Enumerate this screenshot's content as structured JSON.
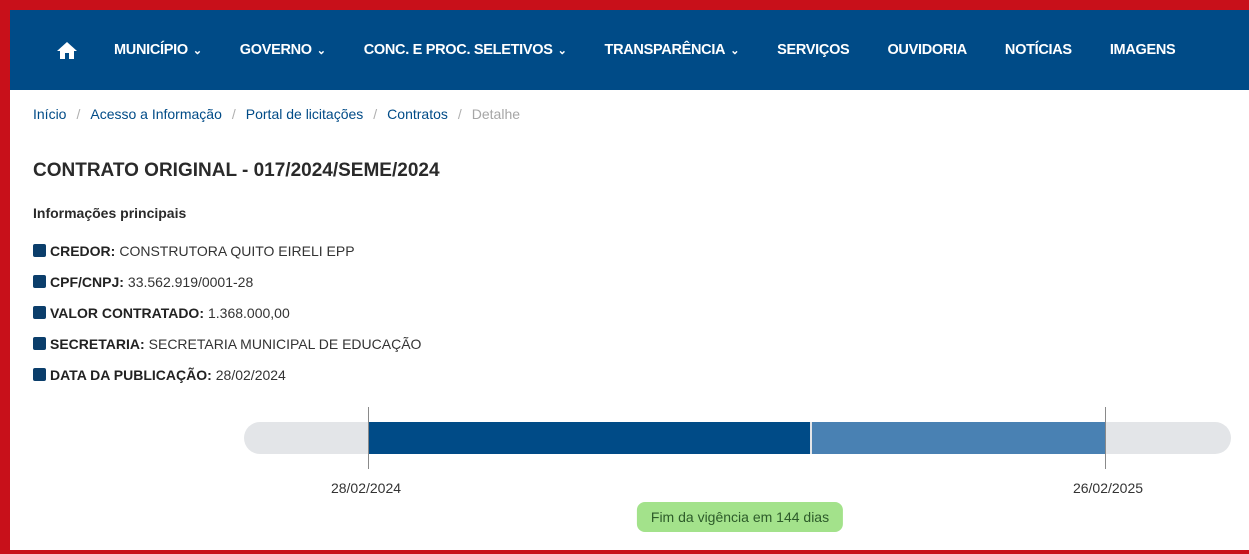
{
  "nav": {
    "home_icon": "home-icon",
    "items": [
      {
        "label": "MUNICÍPIO",
        "dropdown": true
      },
      {
        "label": "GOVERNO",
        "dropdown": true
      },
      {
        "label": "CONC. E PROC. SELETIVOS",
        "dropdown": true
      },
      {
        "label": "TRANSPARÊNCIA",
        "dropdown": true
      },
      {
        "label": "SERVIÇOS",
        "dropdown": false
      },
      {
        "label": "OUVIDORIA",
        "dropdown": false
      },
      {
        "label": "NOTÍCIAS",
        "dropdown": false
      },
      {
        "label": "IMAGENS",
        "dropdown": false
      }
    ],
    "caret": "⌄"
  },
  "breadcrumb": [
    "Início",
    "Acesso a Informação",
    "Portal de licitações",
    "Contratos",
    "Detalhe"
  ],
  "breadcrumb_sep": "/",
  "title": "CONTRATO ORIGINAL - 017/2024/SEME/2024",
  "section_label": "Informações principais",
  "info": [
    {
      "key": "CREDOR:",
      "value": "CONSTRUTORA QUITO EIRELI EPP"
    },
    {
      "key": "CPF/CNPJ:",
      "value": "33.562.919/0001-28"
    },
    {
      "key": "VALOR CONTRATADO:",
      "value": "1.368.000,00"
    },
    {
      "key": "SECRETARIA:",
      "value": "SECRETARIA MUNICIPAL DE EDUCAÇÃO"
    },
    {
      "key": "DATA DA PUBLICAÇÃO:",
      "value": "28/02/2024"
    }
  ],
  "vigencia": {
    "start": "28/02/2024",
    "end": "26/02/2025",
    "elapsed_fraction": 0.6,
    "badge": "Fim da vigência em 144 dias"
  },
  "colors": {
    "nav_bg": "#004b87",
    "elapsed": "#004b87",
    "remaining": "#4981b3",
    "badge_bg": "#a3e28b",
    "frame": "#c8101a"
  }
}
